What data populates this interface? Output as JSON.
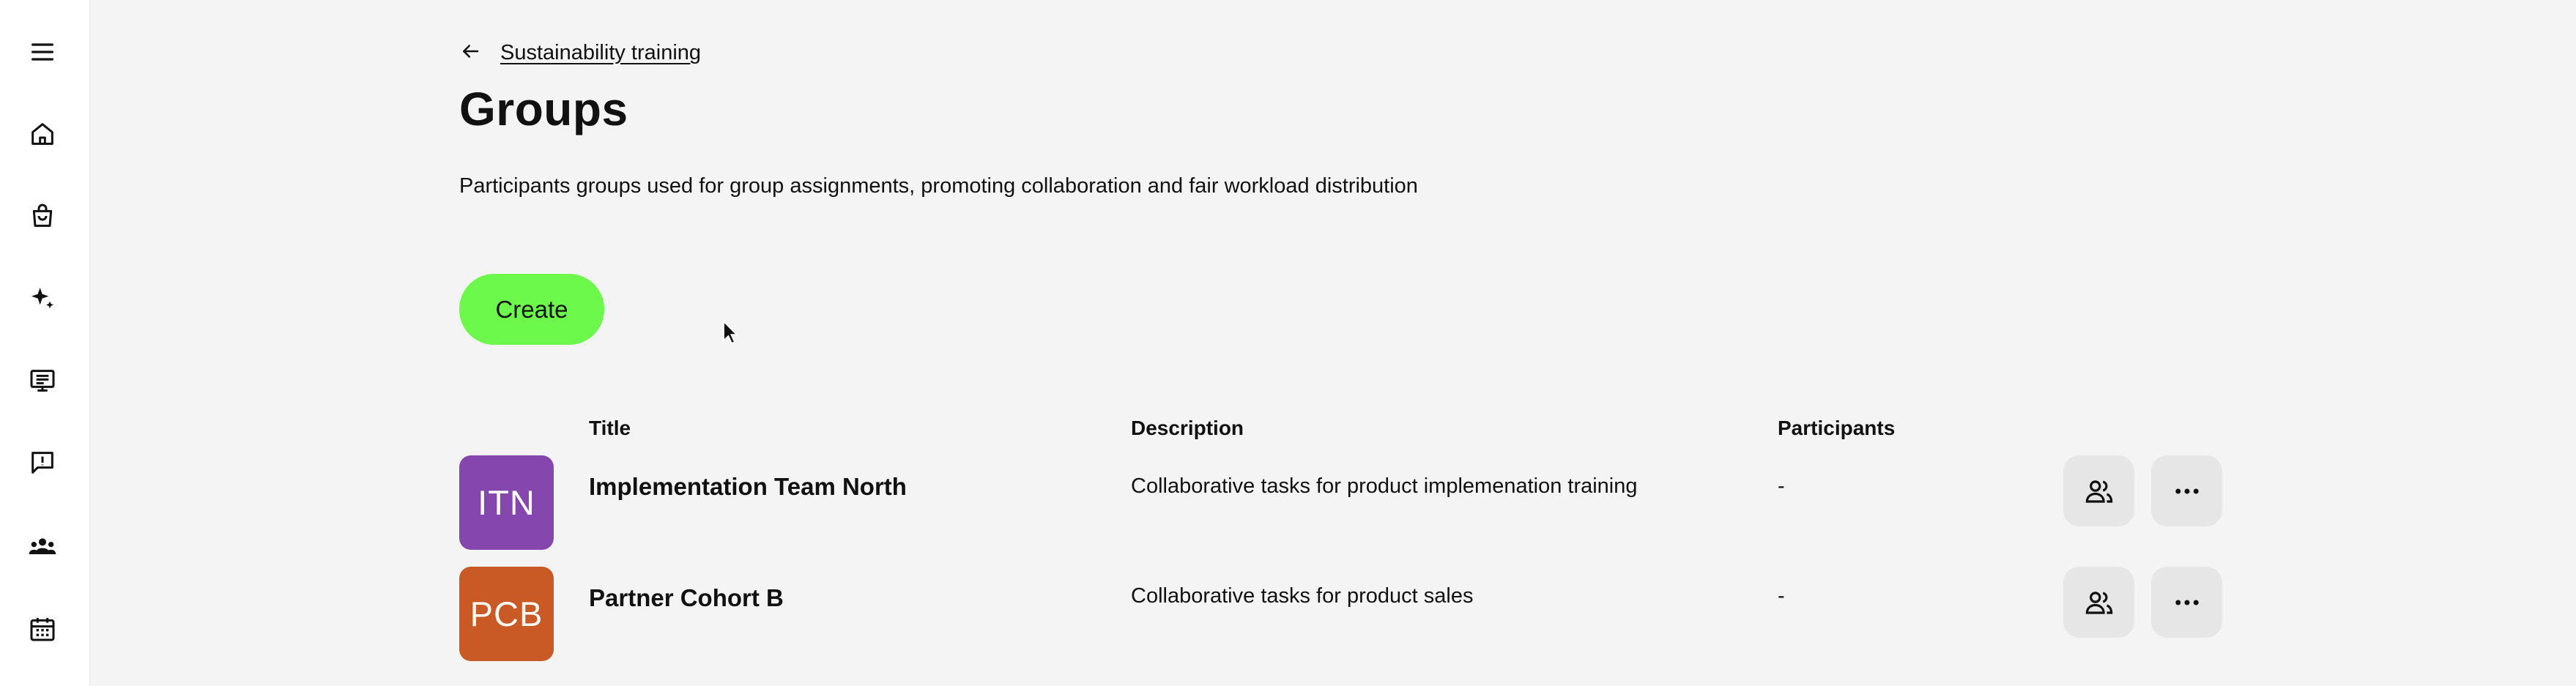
{
  "sidebar": {
    "items": [
      {
        "icon": "menu-icon"
      },
      {
        "icon": "home-icon"
      },
      {
        "icon": "shopping-bag-icon"
      },
      {
        "icon": "sparkles-icon"
      },
      {
        "icon": "presentation-icon"
      },
      {
        "icon": "feedback-icon"
      },
      {
        "icon": "groups-icon"
      },
      {
        "icon": "calendar-icon"
      }
    ]
  },
  "breadcrumb": {
    "back_icon": "arrow-left-icon",
    "label": "Sustainability training"
  },
  "page": {
    "title": "Groups",
    "description": "Participants groups used for group assignments, promoting collaboration and fair workload distribution"
  },
  "create_button": {
    "label": "Create",
    "color": "#6cf94c"
  },
  "table": {
    "headers": {
      "title": "Title",
      "description": "Description",
      "participants": "Participants"
    },
    "rows": [
      {
        "initials": "ITN",
        "avatar_color": "#8547ad",
        "title": "Implementation Team North",
        "description": "Collaborative tasks for product implemenation training",
        "participants": "-",
        "actions": [
          "participants-icon",
          "more-icon"
        ]
      },
      {
        "initials": "PCB",
        "avatar_color": "#c95a26",
        "title": "Partner Cohort B",
        "description": "Collaborative tasks for product sales",
        "participants": "-",
        "actions": [
          "participants-icon",
          "more-icon"
        ]
      }
    ]
  }
}
